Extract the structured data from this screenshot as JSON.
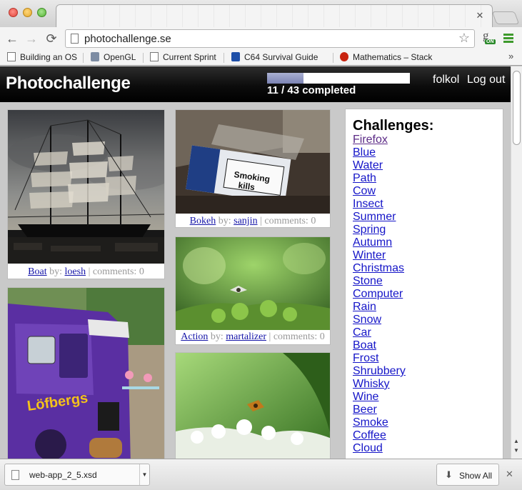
{
  "browser": {
    "url": "photochallenge.se",
    "bookmarks": [
      "Building an OS",
      "OpenGL",
      "Current Sprint",
      "C64 Survival Guide",
      "Mathematics – Stack"
    ],
    "bookmark_icons": [
      "page-icon",
      "opengl-icon",
      "page-icon",
      "c64-icon",
      "stackexchange-icon"
    ],
    "more_bookmarks": "»",
    "extension_badge": "ON"
  },
  "header": {
    "title": "Photochallenge",
    "completed": 11,
    "total": 43,
    "progress_text": "11 / 43 completed",
    "username": "folkol",
    "logout_label": "Log out"
  },
  "photos": [
    {
      "challenge": "Boat",
      "by_label": "by:",
      "author": "loesh",
      "comments_label": "comments: 0"
    },
    {
      "challenge": "Bokeh",
      "by_label": "by:",
      "author": "sanjin",
      "comments_label": "comments: 0"
    },
    {
      "challenge": "Action",
      "by_label": "by:",
      "author": "martalizer",
      "comments_label": "comments: 0"
    }
  ],
  "sidebar": {
    "heading": "Challenges:",
    "items": [
      "Firefox",
      "Blue",
      "Water",
      "Path",
      "Cow",
      "Insect",
      "Summer",
      "Spring",
      "Autumn",
      "Winter",
      "Christmas",
      "Stone",
      "Computer",
      "Rain",
      "Snow",
      "Car",
      "Boat",
      "Frost",
      "Shrubbery",
      "Whisky",
      "Wine",
      "Beer",
      "Smoke",
      "Coffee",
      "Cloud"
    ]
  },
  "downloads": {
    "file_name": "web-app_2_5.xsd",
    "show_all_label": "Show All"
  }
}
